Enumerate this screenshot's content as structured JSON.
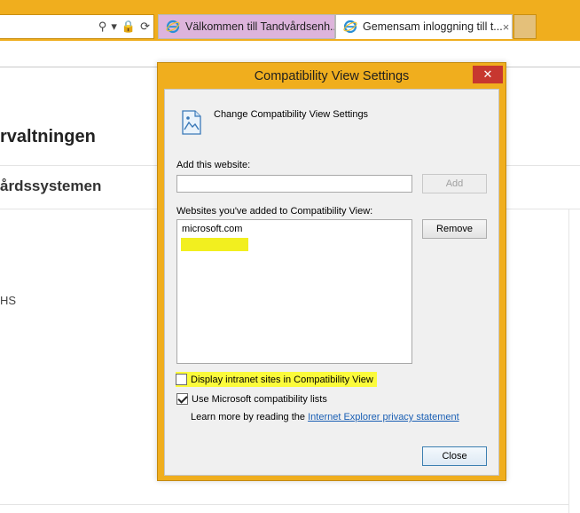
{
  "browser": {
    "tabs": [
      {
        "title": "Välkommen till Tandvårdsenh...",
        "active": false
      },
      {
        "title": "Gemensam inloggning till t...",
        "active": true
      }
    ],
    "address_icons": [
      "search-icon",
      "dropdown-arrow-icon",
      "lock-icon",
      "refresh-icon"
    ],
    "tab_close_glyph": "×"
  },
  "page": {
    "heading": "rvaltningen",
    "subheading": "årdssystemen",
    "fragment": "HS"
  },
  "dialog": {
    "title": "Compatibility View Settings",
    "close_glyph": "✕",
    "header_text": "Change Compatibility View Settings",
    "add_label": "Add this website:",
    "add_input_value": "",
    "add_button": "Add",
    "list_label": "Websites you've added to Compatibility View:",
    "websites": [
      "microsoft.com"
    ],
    "remove_button": "Remove",
    "intranet_checkbox": {
      "label": "Display intranet sites in Compatibility View",
      "checked": false
    },
    "ms_lists_checkbox": {
      "label": "Use Microsoft compatibility lists",
      "checked": true
    },
    "learn_more_text": "Learn more by reading the ",
    "learn_more_link": "Internet Explorer privacy statement",
    "close_button": "Close"
  },
  "colors": {
    "chrome_accent": "#f0ae1e",
    "highlight": "#fbfb3b",
    "close_red": "#c7372f",
    "link": "#1a5fb4"
  }
}
